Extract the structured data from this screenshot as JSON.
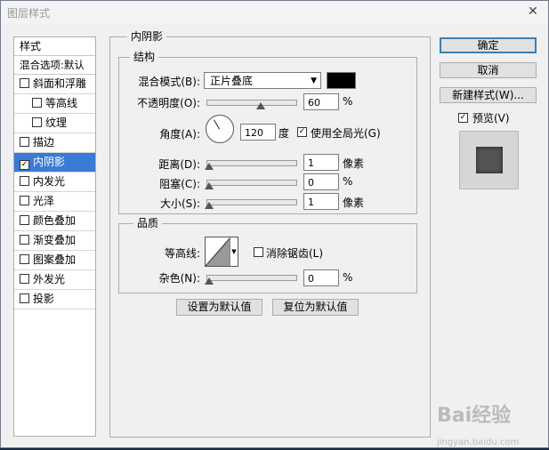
{
  "window": {
    "title": "图层样式",
    "close": "✕"
  },
  "left": {
    "header": "样式",
    "blend_options": "混合选项:默认",
    "items": [
      {
        "label": "斜面和浮雕",
        "checked": false,
        "indent": false
      },
      {
        "label": "等高线",
        "checked": false,
        "indent": true
      },
      {
        "label": "纹理",
        "checked": false,
        "indent": true
      },
      {
        "label": "描边",
        "checked": false,
        "indent": false
      },
      {
        "label": "内阴影",
        "checked": true,
        "indent": false,
        "selected": true
      },
      {
        "label": "内发光",
        "checked": false,
        "indent": false
      },
      {
        "label": "光泽",
        "checked": false,
        "indent": false
      },
      {
        "label": "颜色叠加",
        "checked": false,
        "indent": false
      },
      {
        "label": "渐变叠加",
        "checked": false,
        "indent": false
      },
      {
        "label": "图案叠加",
        "checked": false,
        "indent": false
      },
      {
        "label": "外发光",
        "checked": false,
        "indent": false
      },
      {
        "label": "投影",
        "checked": false,
        "indent": false
      }
    ]
  },
  "main": {
    "section_title": "内阴影",
    "structure": {
      "title": "结构",
      "blend_mode_label": "混合模式(B):",
      "blend_mode_value": "正片叠底",
      "shadow_color": "#000000",
      "opacity_label": "不透明度(O):",
      "opacity_value": "60",
      "opacity_unit": "%",
      "angle_label": "角度(A):",
      "angle_value": "120",
      "angle_unit": "度",
      "global_light_label": "使用全局光(G)",
      "global_light_checked": true,
      "distance_label": "距离(D):",
      "distance_value": "1",
      "distance_unit": "像素",
      "choke_label": "阻塞(C):",
      "choke_value": "0",
      "choke_unit": "%",
      "size_label": "大小(S):",
      "size_value": "1",
      "size_unit": "像素"
    },
    "quality": {
      "title": "品质",
      "contour_label": "等高线:",
      "antialias_label": "消除锯齿(L)",
      "antialias_checked": false,
      "noise_label": "杂色(N):",
      "noise_value": "0",
      "noise_unit": "%"
    },
    "set_default_label": "设置为默认值",
    "reset_default_label": "复位为默认值"
  },
  "right": {
    "ok_label": "确定",
    "cancel_label": "取消",
    "new_style_label": "新建样式(W)...",
    "preview_label": "预览(V)",
    "preview_checked": true
  },
  "watermark": {
    "brand": "Bai",
    "brand2": "经验",
    "url": "jingyan.baidu.com"
  }
}
